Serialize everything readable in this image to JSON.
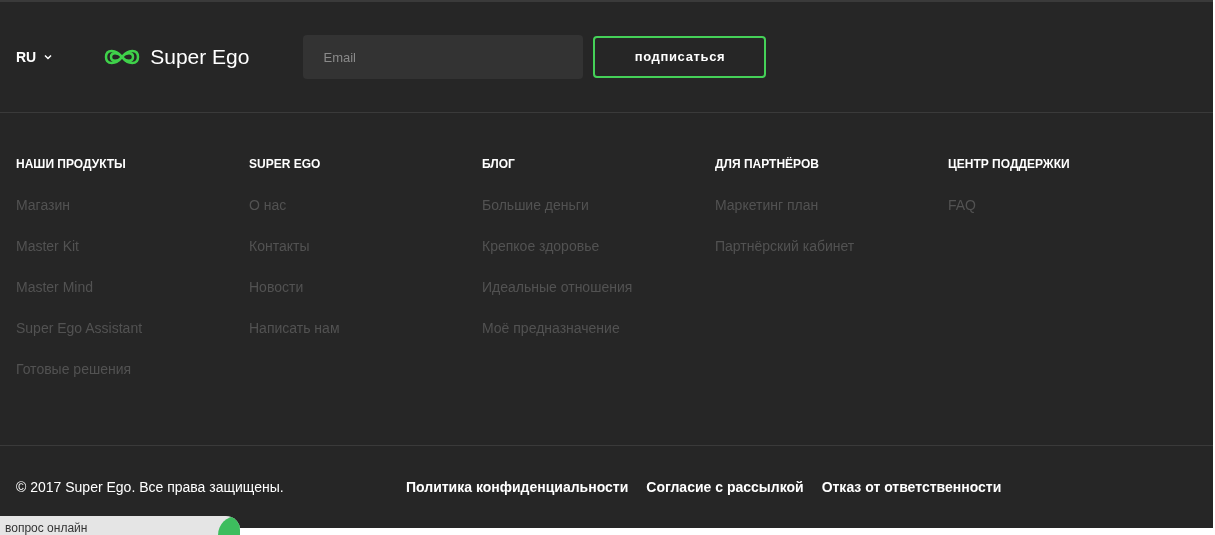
{
  "header": {
    "language": "RU",
    "logo": "Super Ego",
    "email": {
      "placeholder": "Email"
    },
    "subscribe_button": "подписаться"
  },
  "columns": [
    {
      "title": "НАШИ ПРОДУКТЫ",
      "links": [
        "Магазин",
        "Master Kit",
        "Master Mind",
        "Super Ego Assistant",
        "Готовые решения"
      ]
    },
    {
      "title": "SUPER EGO",
      "links": [
        "О нас",
        "Контакты",
        "Новости",
        "Написать нам"
      ]
    },
    {
      "title": "БЛОГ",
      "links": [
        "Большие деньги",
        "Крепкое здоровье",
        "Идеальные отношения",
        "Моё предназначение"
      ]
    },
    {
      "title": "ДЛЯ ПАРТНЁРОВ",
      "links": [
        "Маркетинг план",
        "Партнёрский кабинет"
      ]
    },
    {
      "title": "ЦЕНТР ПОДДЕРЖКИ",
      "links": [
        "FAQ"
      ]
    }
  ],
  "bottom": {
    "copyright": "© 2017 Super Ego. Все права защищены.",
    "links": [
      "Политика конфиденциальности",
      "Согласие с рассылкой",
      "Отказ от ответственности"
    ]
  },
  "chat_widget": {
    "label": "вопрос онлайн"
  }
}
